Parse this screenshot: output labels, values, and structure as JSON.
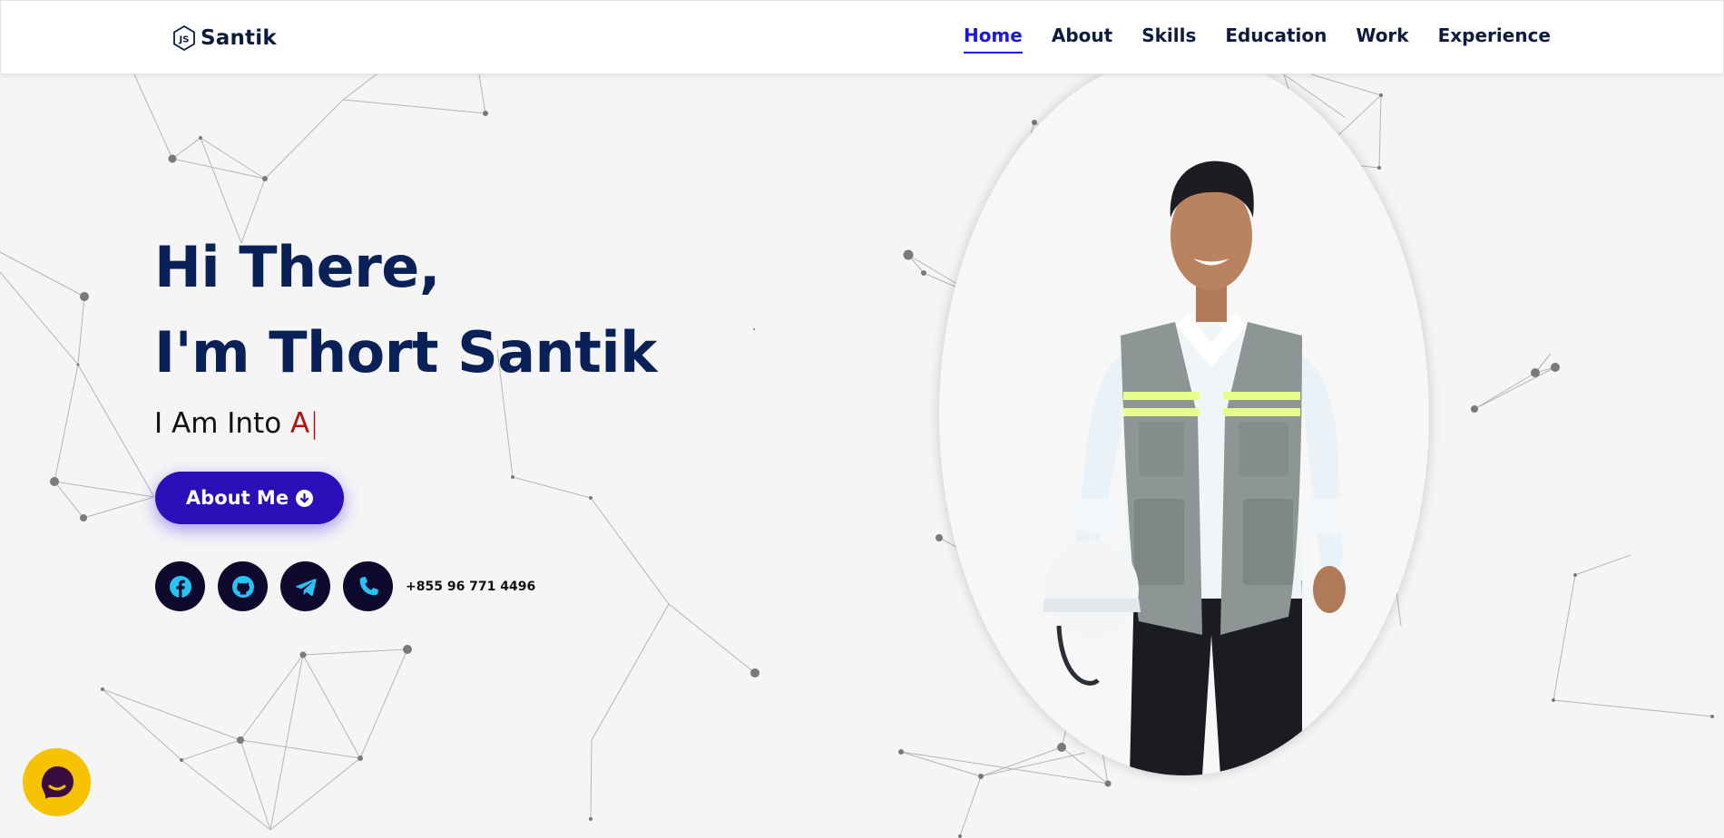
{
  "header": {
    "logo_text": "Santik",
    "nav": [
      {
        "label": "Home",
        "active": true
      },
      {
        "label": "About"
      },
      {
        "label": "Skills"
      },
      {
        "label": "Education"
      },
      {
        "label": "Work"
      },
      {
        "label": "Experience"
      }
    ]
  },
  "hero": {
    "greeting": "Hi There,",
    "name_line": "I'm Thort Santik",
    "into_prefix": "I Am Into ",
    "typed_text": "A",
    "cursor": "|",
    "about_button": "About Me",
    "phone": "+855 96 771 4496",
    "socials": [
      {
        "icon": "facebook-icon"
      },
      {
        "icon": "github-icon"
      },
      {
        "icon": "telegram-icon"
      },
      {
        "icon": "phone-icon"
      }
    ]
  },
  "colors": {
    "accent": "#1a1ad6",
    "heading": "#0a2158",
    "button": "#2a0fb8",
    "typed": "#b01010",
    "icon_cyan": "#27c3f3",
    "chat": "#f7c300"
  }
}
